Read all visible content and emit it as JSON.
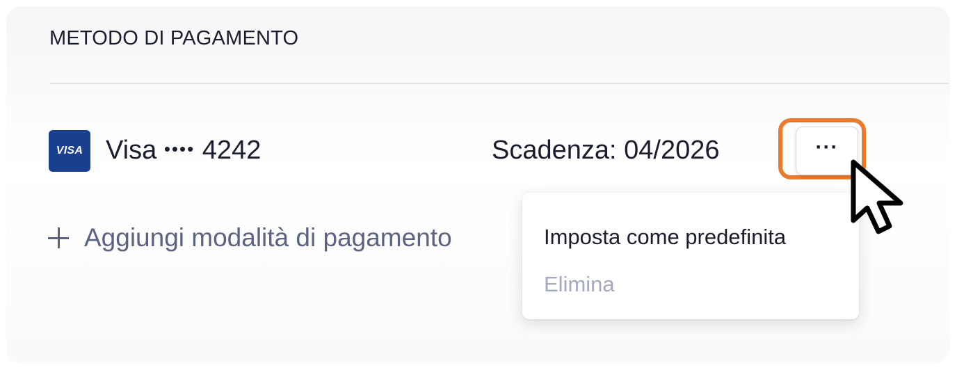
{
  "section": {
    "title": "METODO DI PAGAMENTO"
  },
  "payment_method": {
    "brand_logo": "VISA",
    "brand": "Visa",
    "masked_dots": "••••",
    "last4": "4242",
    "expiry": "Scadenza: 04/2026",
    "more_button_label": "···"
  },
  "add_method": {
    "label": "Aggiungi modalità di pagamento",
    "icon": "plus-icon"
  },
  "menu": {
    "items": [
      {
        "label": "Imposta come predefinita",
        "state": "enabled"
      },
      {
        "label": "Elimina",
        "state": "muted"
      }
    ]
  },
  "colors": {
    "highlight": "#ea7a2c",
    "visa_blue": "#1a3f8f",
    "text_primary": "#1a1d2e",
    "text_secondary": "#5b6380",
    "text_muted": "#a4a9bd"
  }
}
